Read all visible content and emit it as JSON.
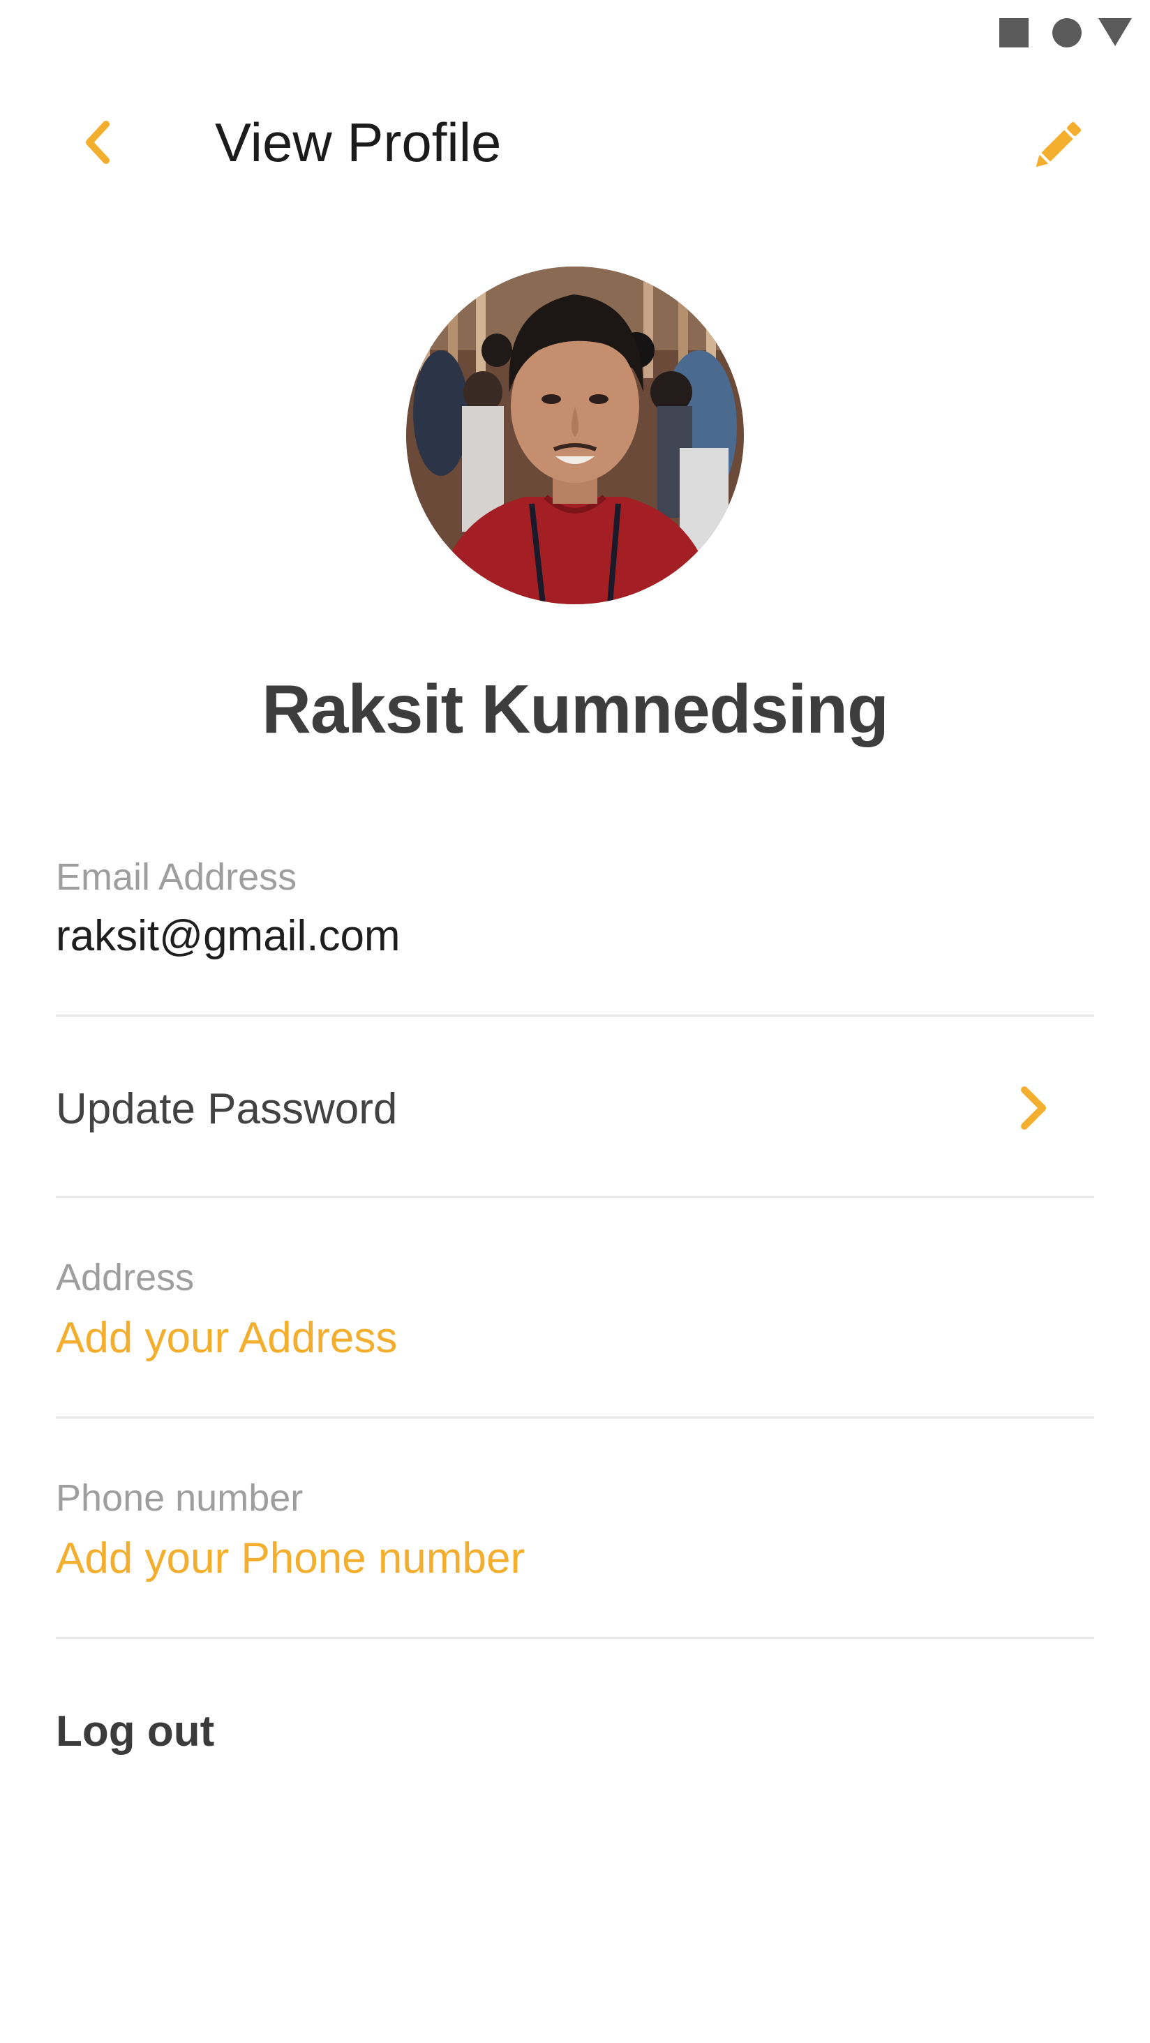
{
  "status_bar": {
    "icons": [
      "stop-square-icon",
      "record-circle-icon",
      "signal-triangle-icon"
    ],
    "icon_color": "#5a5a5a"
  },
  "header": {
    "title": "View Profile",
    "back_icon": "chevron-left-icon",
    "edit_icon": "pencil-icon",
    "accent_color": "#f4ae2e"
  },
  "profile": {
    "avatar": "profile-photo",
    "name": "Raksit Kumnedsing"
  },
  "fields": {
    "email": {
      "label": "Email Address",
      "value": "raksit@gmail.com"
    },
    "password": {
      "label": "Update Password",
      "icon": "chevron-right-icon"
    },
    "address": {
      "label": "Address",
      "value": "Add your Address"
    },
    "phone": {
      "label": "Phone number",
      "value": "Add your Phone number"
    }
  },
  "actions": {
    "logout": "Log out"
  }
}
